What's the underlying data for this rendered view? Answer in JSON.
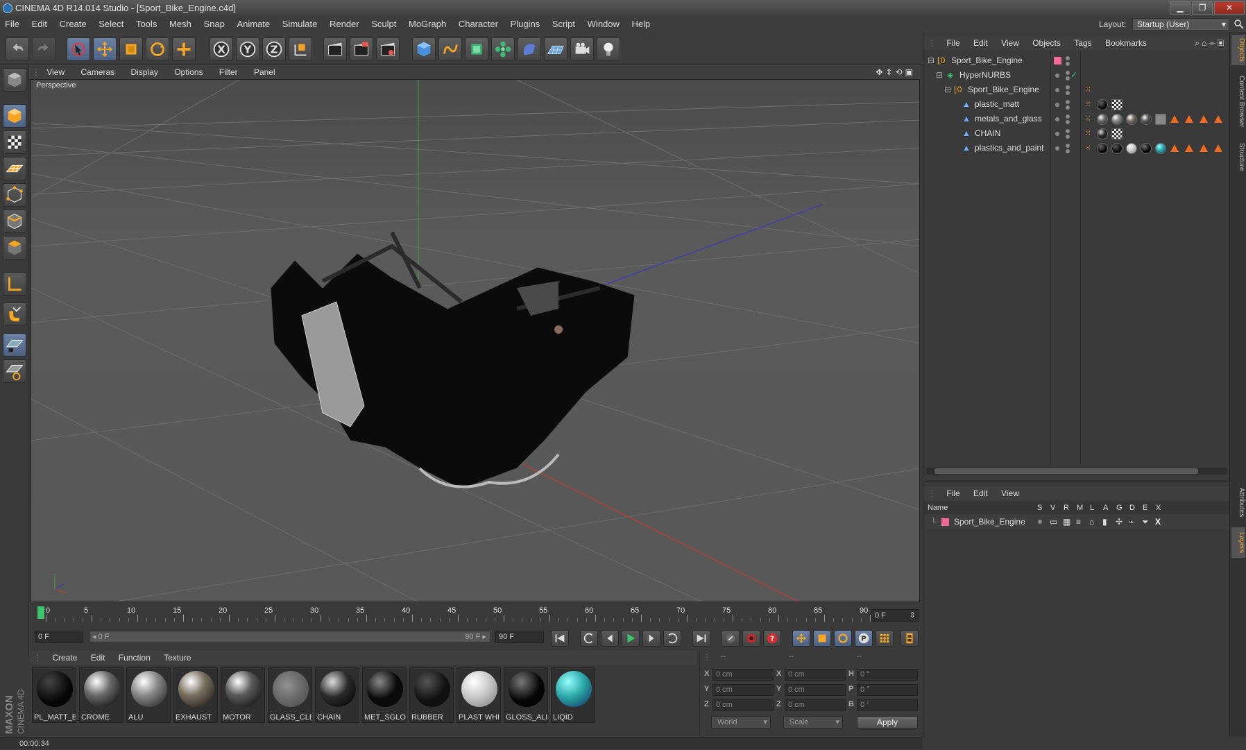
{
  "window": {
    "title": "CINEMA 4D R14.014 Studio - [Sport_Bike_Engine.c4d]",
    "controls": {
      "minimize": "▁",
      "restore": "❐",
      "close": "✕"
    }
  },
  "menubar": {
    "items": [
      "File",
      "Edit",
      "Create",
      "Select",
      "Tools",
      "Mesh",
      "Snap",
      "Animate",
      "Simulate",
      "Render",
      "Sculpt",
      "MoGraph",
      "Character",
      "Plugins",
      "Script",
      "Window",
      "Help"
    ],
    "layout_label": "Layout:",
    "layout_value": "Startup (User)"
  },
  "viewport": {
    "menu": [
      "View",
      "Cameras",
      "Display",
      "Options",
      "Filter",
      "Panel"
    ],
    "label": "Perspective"
  },
  "timeline": {
    "ticks": [
      "0",
      "5",
      "10",
      "15",
      "20",
      "25",
      "30",
      "35",
      "40",
      "45",
      "50",
      "55",
      "60",
      "65",
      "70",
      "75",
      "80",
      "85",
      "90"
    ],
    "current_frame_field": "0 F",
    "start_field": "0 F",
    "range_start": "◂ 0 F",
    "range_end": "90 F ▸",
    "end_field": "90 F",
    "end_frame_display": "0 F"
  },
  "materials": {
    "menu": [
      "Create",
      "Edit",
      "Function",
      "Texture"
    ],
    "items": [
      {
        "name": "PL_MATT_B",
        "color": "#050505"
      },
      {
        "name": "CROME",
        "color": "#6a6a6a"
      },
      {
        "name": "ALU",
        "color": "#8a8a8a"
      },
      {
        "name": "EXHAUST",
        "color": "#7a7060"
      },
      {
        "name": "MOTOR",
        "color": "#5a5a5a"
      },
      {
        "name": "GLASS_CLE",
        "color": "#777777"
      },
      {
        "name": "CHAIN",
        "color": "#2a2a2a"
      },
      {
        "name": "MET_SGLO:",
        "color": "#0a0a0a"
      },
      {
        "name": "RUBBER",
        "color": "#101010"
      },
      {
        "name": "PLAST WHI",
        "color": "#cfcfcf"
      },
      {
        "name": "GLOSS_ALL",
        "color": "#050505"
      },
      {
        "name": "LIQID",
        "color": "#2aa7a7"
      }
    ]
  },
  "coords": {
    "headers": [
      "--",
      "--",
      "--"
    ],
    "rows": [
      {
        "a": "X",
        "av": "0 cm",
        "b": "X",
        "bv": "0 cm",
        "c": "H",
        "cv": "0 °"
      },
      {
        "a": "Y",
        "av": "0 cm",
        "b": "Y",
        "bv": "0 cm",
        "c": "P",
        "cv": "0 °"
      },
      {
        "a": "Z",
        "av": "0 cm",
        "b": "Z",
        "bv": "0 cm",
        "c": "B",
        "cv": "0 °"
      }
    ],
    "mode1": "World",
    "mode2": "Scale",
    "apply": "Apply"
  },
  "status": {
    "time": "00:00:34"
  },
  "objects": {
    "menu": [
      "File",
      "Edit",
      "View",
      "Objects",
      "Tags",
      "Bookmarks"
    ],
    "tree": [
      {
        "name": "Sport_Bike_Engine"
      },
      {
        "name": "HyperNURBS"
      },
      {
        "name": "Sport_Bike_Engine"
      },
      {
        "name": "plastic_matt"
      },
      {
        "name": "metals_and_glass"
      },
      {
        "name": "CHAIN"
      },
      {
        "name": "plastics_and_paint"
      }
    ]
  },
  "layers": {
    "menu": [
      "File",
      "Edit",
      "View"
    ],
    "columns": [
      "Name",
      "S",
      "V",
      "R",
      "M",
      "L",
      "A",
      "G",
      "D",
      "E",
      "X"
    ],
    "rows": [
      {
        "name": "Sport_Bike_Engine"
      }
    ]
  },
  "side_tabs": [
    "Objects",
    "Content Browser",
    "Structure",
    "Attributes",
    "Layers"
  ],
  "brand": {
    "maker": "MAXON",
    "product": "CINEMA 4D"
  }
}
